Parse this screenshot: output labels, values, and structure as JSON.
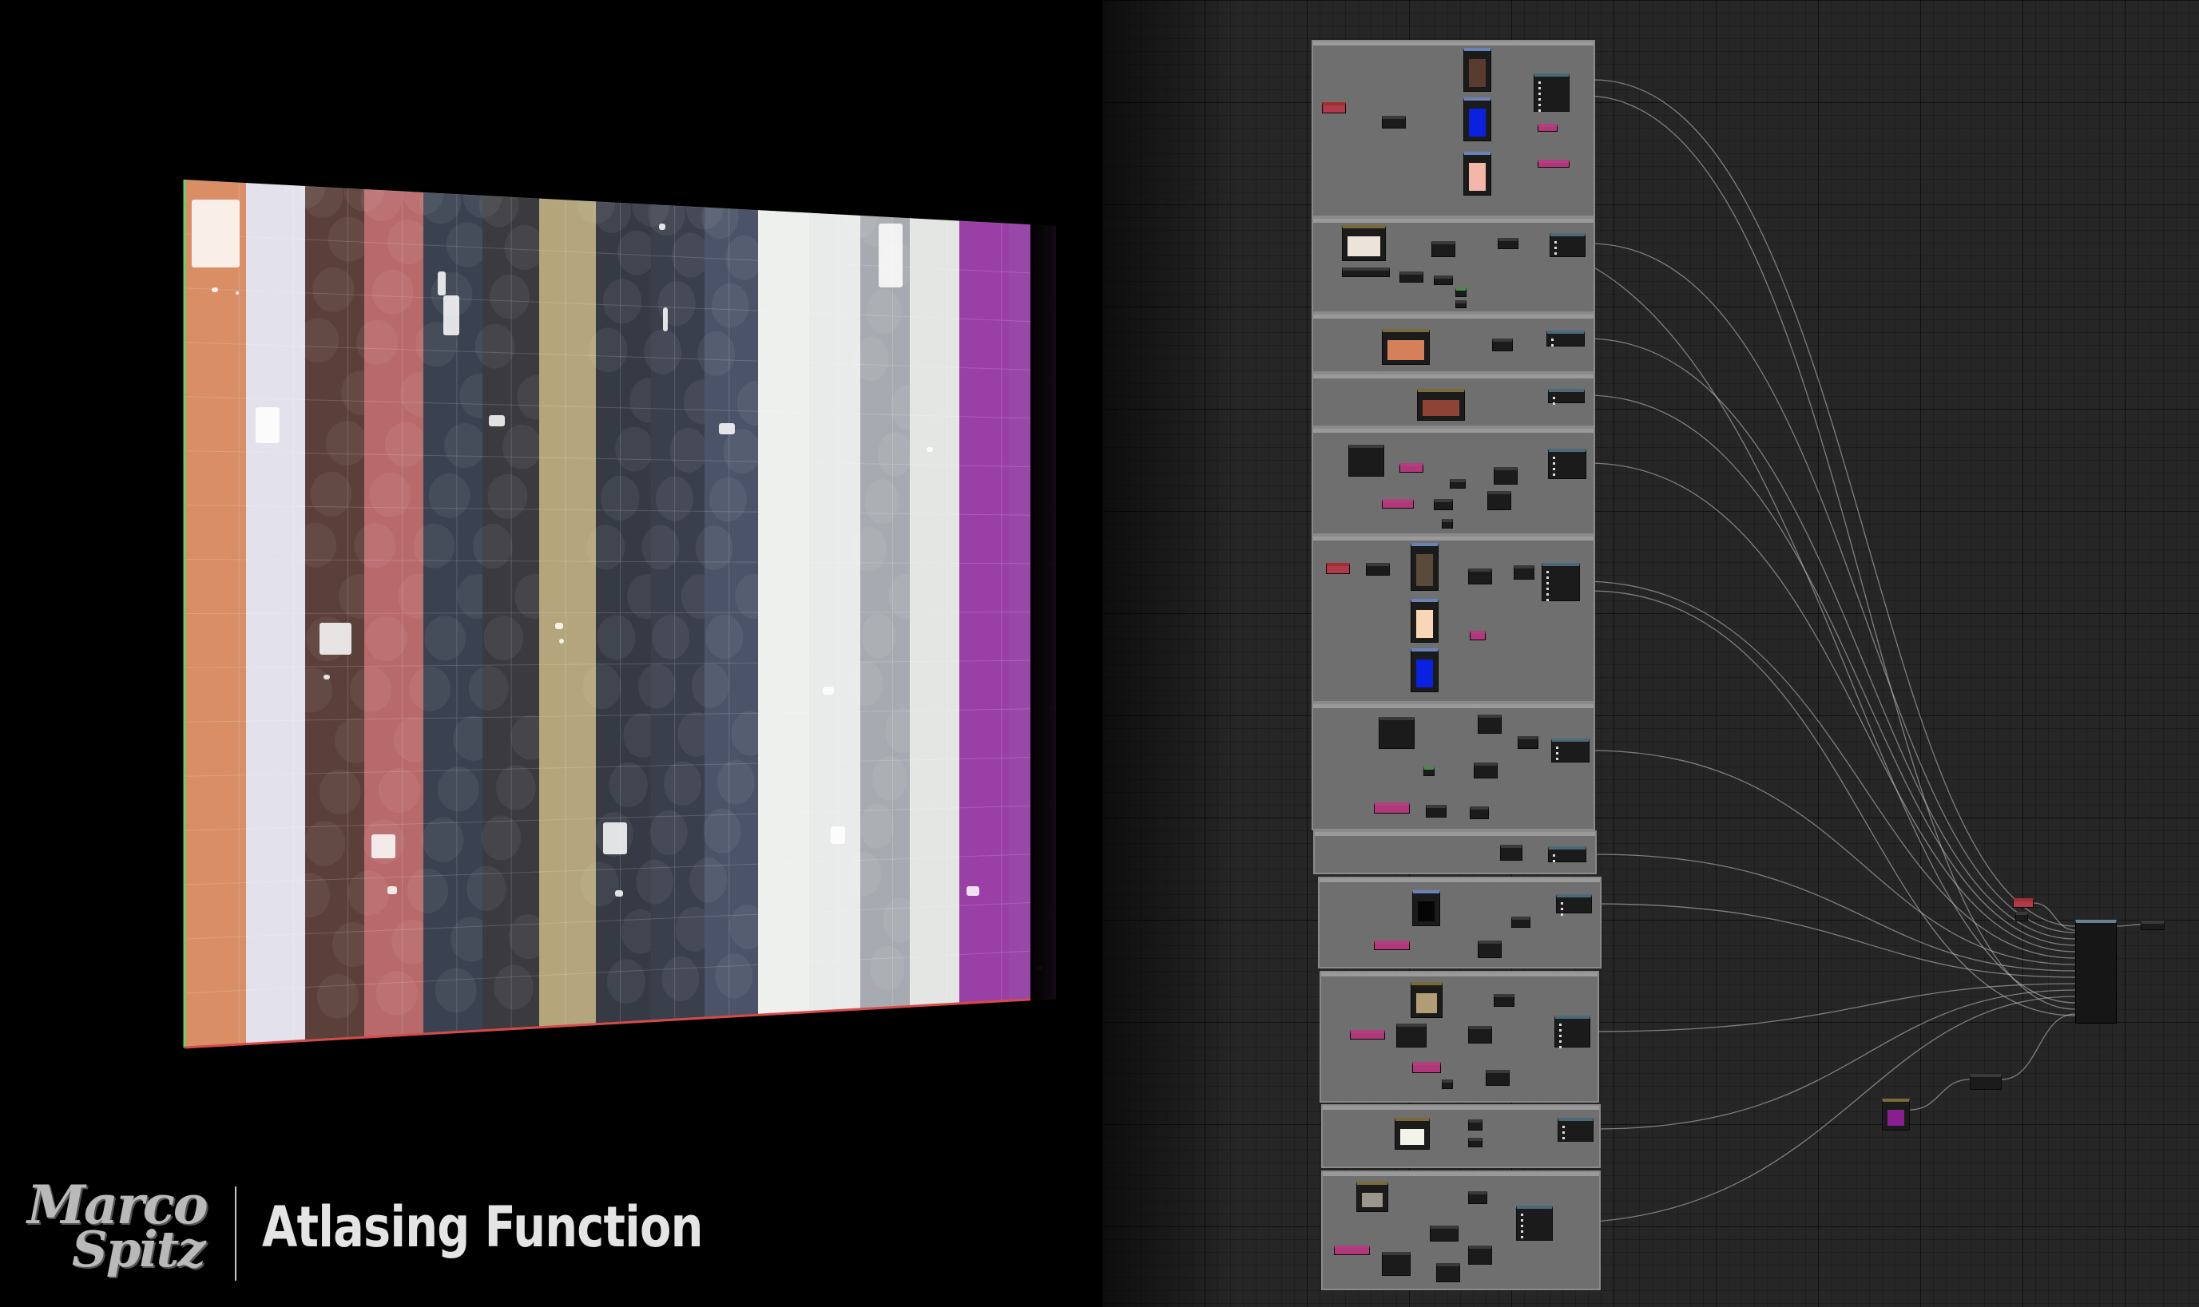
{
  "brand": {
    "logo_line1": "Marco",
    "logo_line2": "Spitz",
    "title": "Atlasing Function"
  },
  "viewport": {
    "preview_strips": [
      {
        "name": "peach",
        "color": "#d98e66"
      },
      {
        "name": "pale-lavender",
        "color": "#e3e2ec"
      },
      {
        "name": "dark-brown",
        "color": "#5a4038"
      },
      {
        "name": "dusty-rose",
        "color": "#b8696a"
      },
      {
        "name": "slate-pattern",
        "color": "#3a4150"
      },
      {
        "name": "charcoal",
        "color": "#3a3a3f"
      },
      {
        "name": "khaki",
        "color": "#b4a57c"
      },
      {
        "name": "dark-slate",
        "color": "#363a45"
      },
      {
        "name": "dark-slate-2",
        "color": "#3a3f4c"
      },
      {
        "name": "navy-slate",
        "color": "#4b5368"
      },
      {
        "name": "off-white",
        "color": "#eef0ee"
      },
      {
        "name": "off-white-2",
        "color": "#e8ebe9"
      },
      {
        "name": "silver-pattern",
        "color": "#a7aab0"
      },
      {
        "name": "light-grey",
        "color": "#e4e6e4"
      },
      {
        "name": "purple",
        "color": "#9a3fa6"
      },
      {
        "name": "violet",
        "color": "#9848a8"
      }
    ]
  },
  "graph": {
    "comment_groups_count": 13,
    "swatch_colors": {
      "brown": "#5a3b30",
      "blue": "#0a22e0",
      "salmon": "#f3b7a7",
      "cream": "#ece4da",
      "orange": "#d6805a",
      "rust": "#8f4236",
      "tan": "#5a4a3c",
      "peach": "#f8d6b6",
      "black": "#050505",
      "khaki": "#b29c74",
      "ivory": "#f2f4ea",
      "grey": "#9a968c",
      "magenta": "#8a1e8e"
    }
  },
  "colors": {
    "background": "#000000",
    "graph_bg": "#262626",
    "comment_box": "#6f6f6f",
    "node_body": "#1b1b1b",
    "wire": "#bdbdbd"
  }
}
